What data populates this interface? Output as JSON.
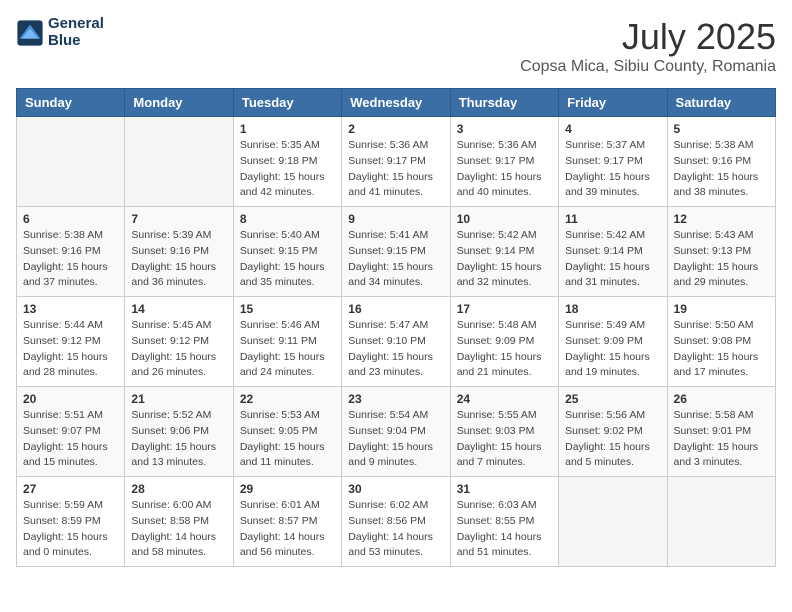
{
  "header": {
    "logo_line1": "General",
    "logo_line2": "Blue",
    "title": "July 2025",
    "subtitle": "Copsa Mica, Sibiu County, Romania"
  },
  "weekdays": [
    "Sunday",
    "Monday",
    "Tuesday",
    "Wednesday",
    "Thursday",
    "Friday",
    "Saturday"
  ],
  "weeks": [
    [
      {
        "day": "",
        "sunrise": "",
        "sunset": "",
        "daylight": ""
      },
      {
        "day": "",
        "sunrise": "",
        "sunset": "",
        "daylight": ""
      },
      {
        "day": "1",
        "sunrise": "Sunrise: 5:35 AM",
        "sunset": "Sunset: 9:18 PM",
        "daylight": "Daylight: 15 hours and 42 minutes."
      },
      {
        "day": "2",
        "sunrise": "Sunrise: 5:36 AM",
        "sunset": "Sunset: 9:17 PM",
        "daylight": "Daylight: 15 hours and 41 minutes."
      },
      {
        "day": "3",
        "sunrise": "Sunrise: 5:36 AM",
        "sunset": "Sunset: 9:17 PM",
        "daylight": "Daylight: 15 hours and 40 minutes."
      },
      {
        "day": "4",
        "sunrise": "Sunrise: 5:37 AM",
        "sunset": "Sunset: 9:17 PM",
        "daylight": "Daylight: 15 hours and 39 minutes."
      },
      {
        "day": "5",
        "sunrise": "Sunrise: 5:38 AM",
        "sunset": "Sunset: 9:16 PM",
        "daylight": "Daylight: 15 hours and 38 minutes."
      }
    ],
    [
      {
        "day": "6",
        "sunrise": "Sunrise: 5:38 AM",
        "sunset": "Sunset: 9:16 PM",
        "daylight": "Daylight: 15 hours and 37 minutes."
      },
      {
        "day": "7",
        "sunrise": "Sunrise: 5:39 AM",
        "sunset": "Sunset: 9:16 PM",
        "daylight": "Daylight: 15 hours and 36 minutes."
      },
      {
        "day": "8",
        "sunrise": "Sunrise: 5:40 AM",
        "sunset": "Sunset: 9:15 PM",
        "daylight": "Daylight: 15 hours and 35 minutes."
      },
      {
        "day": "9",
        "sunrise": "Sunrise: 5:41 AM",
        "sunset": "Sunset: 9:15 PM",
        "daylight": "Daylight: 15 hours and 34 minutes."
      },
      {
        "day": "10",
        "sunrise": "Sunrise: 5:42 AM",
        "sunset": "Sunset: 9:14 PM",
        "daylight": "Daylight: 15 hours and 32 minutes."
      },
      {
        "day": "11",
        "sunrise": "Sunrise: 5:42 AM",
        "sunset": "Sunset: 9:14 PM",
        "daylight": "Daylight: 15 hours and 31 minutes."
      },
      {
        "day": "12",
        "sunrise": "Sunrise: 5:43 AM",
        "sunset": "Sunset: 9:13 PM",
        "daylight": "Daylight: 15 hours and 29 minutes."
      }
    ],
    [
      {
        "day": "13",
        "sunrise": "Sunrise: 5:44 AM",
        "sunset": "Sunset: 9:12 PM",
        "daylight": "Daylight: 15 hours and 28 minutes."
      },
      {
        "day": "14",
        "sunrise": "Sunrise: 5:45 AM",
        "sunset": "Sunset: 9:12 PM",
        "daylight": "Daylight: 15 hours and 26 minutes."
      },
      {
        "day": "15",
        "sunrise": "Sunrise: 5:46 AM",
        "sunset": "Sunset: 9:11 PM",
        "daylight": "Daylight: 15 hours and 24 minutes."
      },
      {
        "day": "16",
        "sunrise": "Sunrise: 5:47 AM",
        "sunset": "Sunset: 9:10 PM",
        "daylight": "Daylight: 15 hours and 23 minutes."
      },
      {
        "day": "17",
        "sunrise": "Sunrise: 5:48 AM",
        "sunset": "Sunset: 9:09 PM",
        "daylight": "Daylight: 15 hours and 21 minutes."
      },
      {
        "day": "18",
        "sunrise": "Sunrise: 5:49 AM",
        "sunset": "Sunset: 9:09 PM",
        "daylight": "Daylight: 15 hours and 19 minutes."
      },
      {
        "day": "19",
        "sunrise": "Sunrise: 5:50 AM",
        "sunset": "Sunset: 9:08 PM",
        "daylight": "Daylight: 15 hours and 17 minutes."
      }
    ],
    [
      {
        "day": "20",
        "sunrise": "Sunrise: 5:51 AM",
        "sunset": "Sunset: 9:07 PM",
        "daylight": "Daylight: 15 hours and 15 minutes."
      },
      {
        "day": "21",
        "sunrise": "Sunrise: 5:52 AM",
        "sunset": "Sunset: 9:06 PM",
        "daylight": "Daylight: 15 hours and 13 minutes."
      },
      {
        "day": "22",
        "sunrise": "Sunrise: 5:53 AM",
        "sunset": "Sunset: 9:05 PM",
        "daylight": "Daylight: 15 hours and 11 minutes."
      },
      {
        "day": "23",
        "sunrise": "Sunrise: 5:54 AM",
        "sunset": "Sunset: 9:04 PM",
        "daylight": "Daylight: 15 hours and 9 minutes."
      },
      {
        "day": "24",
        "sunrise": "Sunrise: 5:55 AM",
        "sunset": "Sunset: 9:03 PM",
        "daylight": "Daylight: 15 hours and 7 minutes."
      },
      {
        "day": "25",
        "sunrise": "Sunrise: 5:56 AM",
        "sunset": "Sunset: 9:02 PM",
        "daylight": "Daylight: 15 hours and 5 minutes."
      },
      {
        "day": "26",
        "sunrise": "Sunrise: 5:58 AM",
        "sunset": "Sunset: 9:01 PM",
        "daylight": "Daylight: 15 hours and 3 minutes."
      }
    ],
    [
      {
        "day": "27",
        "sunrise": "Sunrise: 5:59 AM",
        "sunset": "Sunset: 8:59 PM",
        "daylight": "Daylight: 15 hours and 0 minutes."
      },
      {
        "day": "28",
        "sunrise": "Sunrise: 6:00 AM",
        "sunset": "Sunset: 8:58 PM",
        "daylight": "Daylight: 14 hours and 58 minutes."
      },
      {
        "day": "29",
        "sunrise": "Sunrise: 6:01 AM",
        "sunset": "Sunset: 8:57 PM",
        "daylight": "Daylight: 14 hours and 56 minutes."
      },
      {
        "day": "30",
        "sunrise": "Sunrise: 6:02 AM",
        "sunset": "Sunset: 8:56 PM",
        "daylight": "Daylight: 14 hours and 53 minutes."
      },
      {
        "day": "31",
        "sunrise": "Sunrise: 6:03 AM",
        "sunset": "Sunset: 8:55 PM",
        "daylight": "Daylight: 14 hours and 51 minutes."
      },
      {
        "day": "",
        "sunrise": "",
        "sunset": "",
        "daylight": ""
      },
      {
        "day": "",
        "sunrise": "",
        "sunset": "",
        "daylight": ""
      }
    ]
  ]
}
